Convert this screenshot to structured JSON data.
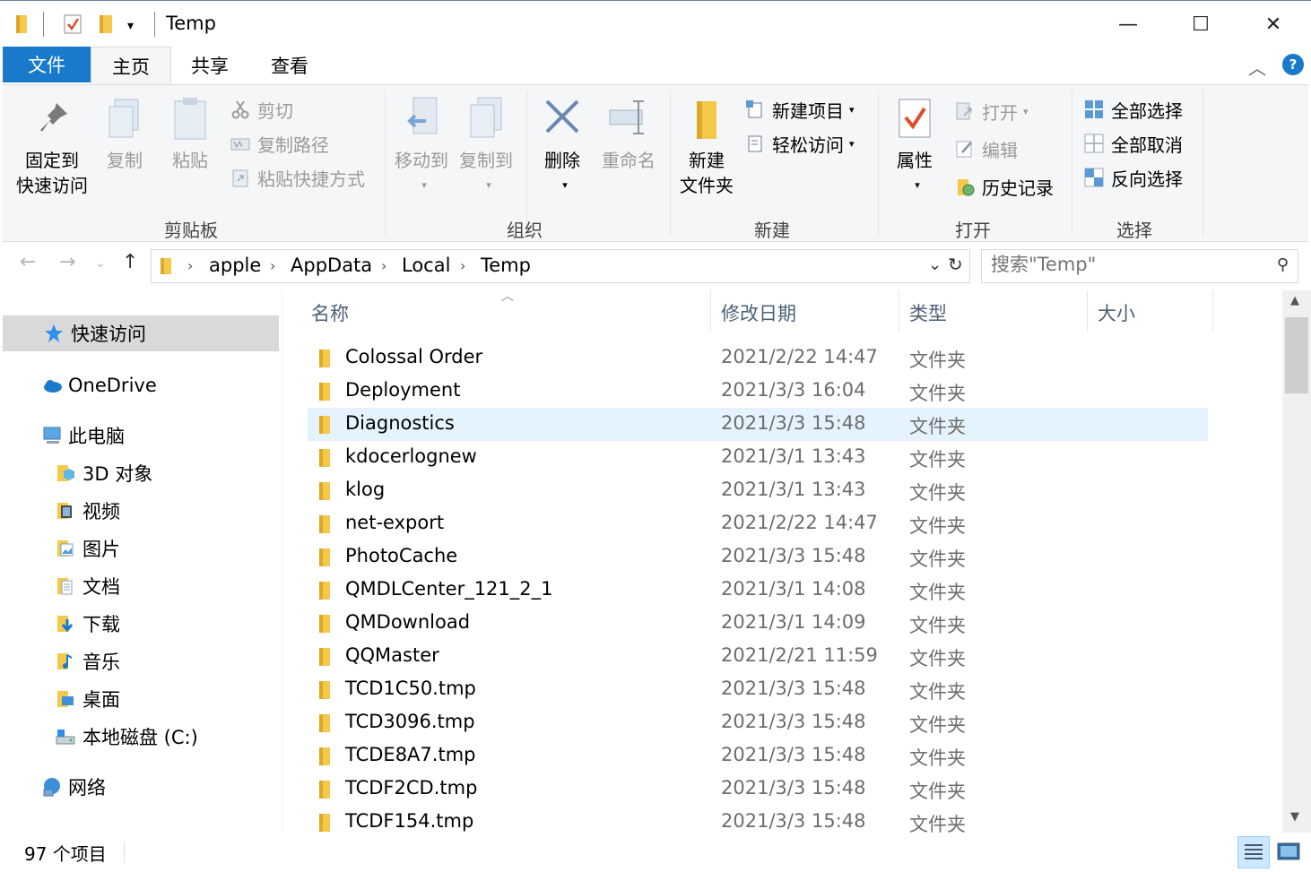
{
  "window": {
    "title": "Temp",
    "minimize_glyph": "—",
    "maximize_glyph": "☐",
    "close_glyph": "✕"
  },
  "tabs": {
    "file": "文件",
    "home": "主页",
    "share": "共享",
    "view": "查看"
  },
  "ribbon": {
    "clipboard": {
      "label": "剪贴板",
      "pin_line1": "固定到",
      "pin_line2": "快速访问",
      "copy": "复制",
      "paste": "粘贴",
      "cut": "剪切",
      "copy_path": "复制路径",
      "paste_shortcut": "粘贴快捷方式"
    },
    "organize": {
      "label": "组织",
      "move_to": "移动到",
      "copy_to": "复制到",
      "delete": "删除",
      "rename": "重命名"
    },
    "new": {
      "label": "新建",
      "new_folder_line1": "新建",
      "new_folder_line2": "文件夹",
      "new_item": "新建项目",
      "easy_access": "轻松访问"
    },
    "open": {
      "label": "打开",
      "properties": "属性",
      "open": "打开",
      "edit": "编辑",
      "history": "历史记录"
    },
    "select": {
      "label": "选择",
      "select_all": "全部选择",
      "select_none": "全部取消",
      "invert": "反向选择"
    }
  },
  "address": {
    "crumbs": [
      "apple",
      "AppData",
      "Local",
      "Temp"
    ],
    "search_placeholder": "搜索\"Temp\""
  },
  "nav": {
    "quick_access": "快速访问",
    "onedrive": "OneDrive",
    "this_pc": "此电脑",
    "objects3d": "3D 对象",
    "videos": "视频",
    "pictures": "图片",
    "documents": "文档",
    "downloads": "下载",
    "music": "音乐",
    "desktop": "桌面",
    "local_disk": "本地磁盘 (C:)",
    "network": "网络"
  },
  "columns": {
    "name": "名称",
    "modified": "修改日期",
    "type": "类型",
    "size": "大小"
  },
  "files": [
    {
      "name": "Colossal Order",
      "date": "2021/2/22 14:47",
      "type": "文件夹"
    },
    {
      "name": "Deployment",
      "date": "2021/3/3 16:04",
      "type": "文件夹"
    },
    {
      "name": "Diagnostics",
      "date": "2021/3/3 15:48",
      "type": "文件夹"
    },
    {
      "name": "kdocerlognew",
      "date": "2021/3/1 13:43",
      "type": "文件夹"
    },
    {
      "name": "klog",
      "date": "2021/3/1 13:43",
      "type": "文件夹"
    },
    {
      "name": "net-export",
      "date": "2021/2/22 14:47",
      "type": "文件夹"
    },
    {
      "name": "PhotoCache",
      "date": "2021/3/3 15:48",
      "type": "文件夹"
    },
    {
      "name": "QMDLCenter_121_2_1",
      "date": "2021/3/1 14:08",
      "type": "文件夹"
    },
    {
      "name": "QMDownload",
      "date": "2021/3/1 14:09",
      "type": "文件夹"
    },
    {
      "name": "QQMaster",
      "date": "2021/2/21 11:59",
      "type": "文件夹"
    },
    {
      "name": "TCD1C50.tmp",
      "date": "2021/3/3 15:48",
      "type": "文件夹"
    },
    {
      "name": "TCD3096.tmp",
      "date": "2021/3/3 15:48",
      "type": "文件夹"
    },
    {
      "name": "TCDE8A7.tmp",
      "date": "2021/3/3 15:48",
      "type": "文件夹"
    },
    {
      "name": "TCDF2CD.tmp",
      "date": "2021/3/3 15:48",
      "type": "文件夹"
    },
    {
      "name": "TCDF154.tmp",
      "date": "2021/3/3 15:48",
      "type": "文件夹"
    }
  ],
  "selected_file": "Diagnostics",
  "status": {
    "item_count": "97 个项目"
  },
  "colors": {
    "accent": "#1979ca",
    "folder": "#f3c84b",
    "selection": "#e5f3ff",
    "nav_selected": "#d9d9d9"
  }
}
